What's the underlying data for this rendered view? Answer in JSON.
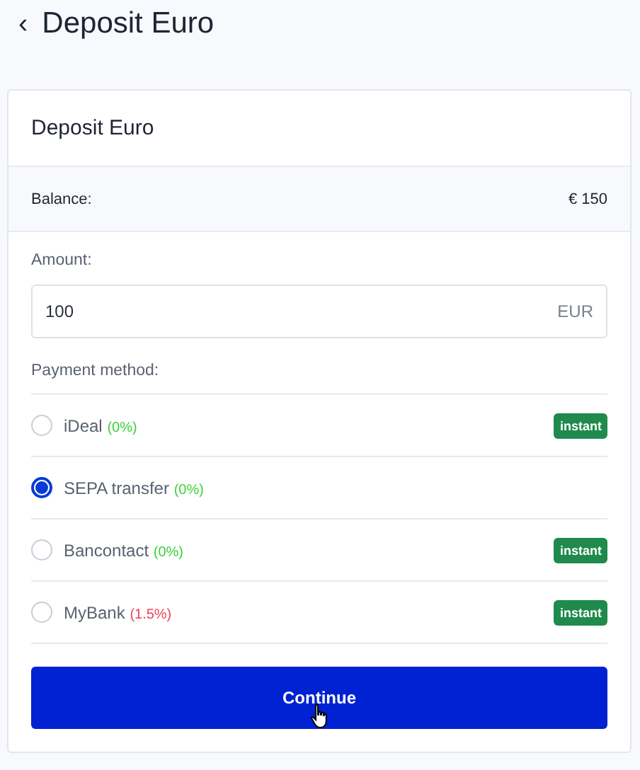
{
  "header": {
    "back": "‹",
    "title": "Deposit Euro"
  },
  "card": {
    "title": "Deposit Euro",
    "balance": {
      "label": "Balance:",
      "value": "€ 150"
    },
    "amount": {
      "label": "Amount:",
      "value": "100",
      "unit": "EUR"
    },
    "payment_label": "Payment method:",
    "methods": [
      {
        "name": "iDeal",
        "fee": "(0%)",
        "color": "#3ad13a",
        "selected": false,
        "badge": "instant"
      },
      {
        "name": "SEPA transfer",
        "fee": "(0%)",
        "color": "#3ad13a",
        "selected": true
      },
      {
        "name": "Bancontact",
        "fee": "(0%)",
        "color": "#3ad13a",
        "selected": false,
        "badge": "instant"
      },
      {
        "name": "MyBank",
        "fee": "(1.5%)",
        "color": "#f0405a",
        "selected": false,
        "badge": "instant"
      }
    ],
    "button": "Continue"
  }
}
